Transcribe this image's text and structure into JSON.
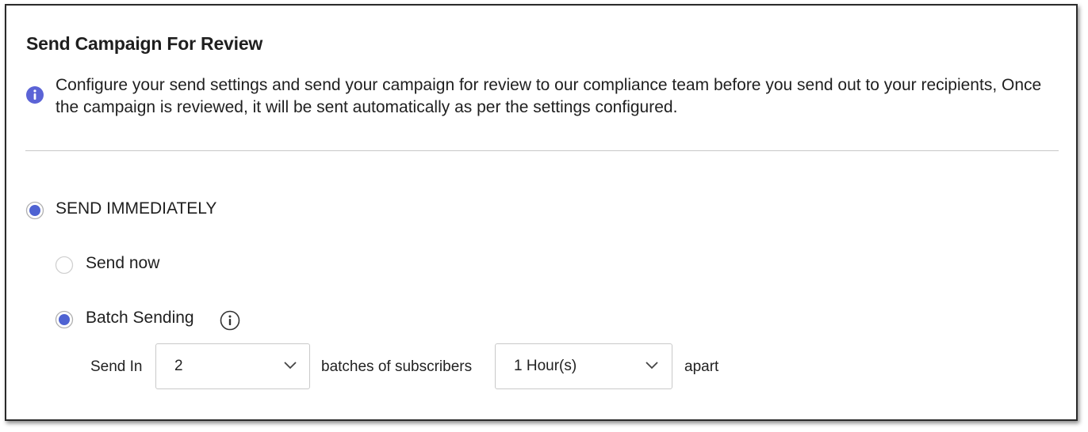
{
  "dialog": {
    "title": "Send Campaign For Review",
    "info_text": "Configure your send settings and send your campaign for review to our compliance team before you send out to your recipients, Once the campaign is reviewed, it will be sent automatically as per the settings configured."
  },
  "options": {
    "send_immediately": {
      "label": "SEND IMMEDIATELY",
      "selected": true
    },
    "send_now": {
      "label": "Send now",
      "selected": false
    },
    "batch_sending": {
      "label": "Batch Sending",
      "selected": true
    }
  },
  "batch": {
    "send_in_label": "Send In",
    "batches_value": "2",
    "batches_label": "batches of subscribers",
    "interval_value": "1 Hour(s)",
    "apart_label": "apart"
  },
  "colors": {
    "accent": "#4f63d2",
    "info_icon": "#5b63d6",
    "border": "#c9c9c9"
  },
  "icons": {
    "info": "info-circle-filled-icon",
    "help": "info-circle-outline-icon",
    "dropdown": "chevron-down-icon"
  }
}
